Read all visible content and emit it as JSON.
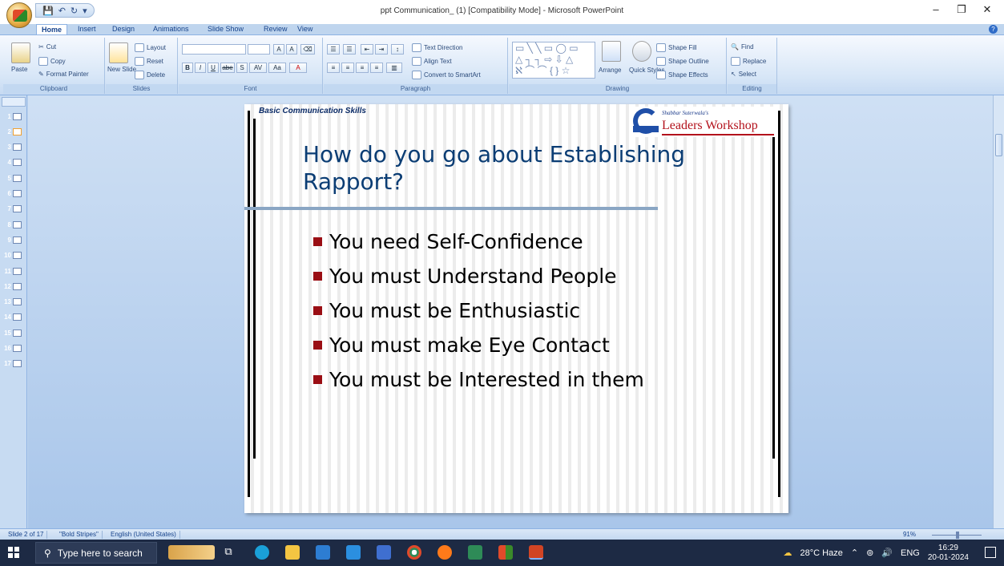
{
  "window": {
    "title": "ppt Communication_ (1) [Compatibility Mode] - Microsoft PowerPoint",
    "minimize": "–",
    "restore": "❐",
    "close": "✕"
  },
  "qat": {
    "save": "💾",
    "undo": "↶",
    "redo": "↻",
    "customize": "▾"
  },
  "tabs": [
    "Home",
    "Insert",
    "Design",
    "Animations",
    "Slide Show",
    "Review",
    "View"
  ],
  "ribbon": {
    "clipboard": {
      "label": "Clipboard",
      "paste": "Paste",
      "cut": "Cut",
      "copy": "Copy",
      "format_painter": "Format Painter"
    },
    "slides": {
      "label": "Slides",
      "new_slide": "New Slide",
      "layout": "Layout",
      "reset": "Reset",
      "delete": "Delete"
    },
    "font": {
      "label": "Font",
      "bold": "B",
      "italic": "I",
      "underline": "U",
      "strike": "abe",
      "shadow": "S",
      "spacing": "AV",
      "case": "Aa",
      "color": "A",
      "grow": "A",
      "shrink": "A"
    },
    "paragraph": {
      "label": "Paragraph",
      "text_direction": "Text Direction",
      "align_text": "Align Text",
      "convert_smartart": "Convert to SmartArt"
    },
    "drawing": {
      "label": "Drawing",
      "arrange": "Arrange",
      "quick_styles": "Quick Styles",
      "shape_fill": "Shape Fill",
      "shape_outline": "Shape Outline",
      "shape_effects": "Shape Effects"
    },
    "editing": {
      "label": "Editing",
      "find": "Find",
      "replace": "Replace",
      "select": "Select"
    }
  },
  "thumbnails": [
    "1",
    "2",
    "3",
    "4",
    "5",
    "6",
    "7",
    "8",
    "9",
    "10",
    "11",
    "12",
    "13",
    "14",
    "15",
    "16",
    "17"
  ],
  "slide": {
    "header": "Basic Communication Skills",
    "brand_small": "Shabbar Suterwala's",
    "brand_main": "Leaders Workshop",
    "title": "How do you go about Establishing Rapport?",
    "bullets": [
      "You need Self-Confidence",
      "You must Understand People",
      "You must be Enthusiastic",
      "You must make Eye Contact",
      "You must be Interested in them"
    ]
  },
  "status": {
    "slide_count": "Slide 2 of 17",
    "theme": "\"Bold Stripes\"",
    "language": "English (United States)",
    "zoom": "91%"
  },
  "taskbar": {
    "search_placeholder": "Type here to search",
    "weather": "28°C  Haze",
    "lang": "ENG",
    "time": "16:29",
    "date": "20-01-2024"
  },
  "colors": {
    "accent": "#15428b",
    "slide_title": "#0b3d74",
    "bullet": "#9a0e14",
    "brand_red": "#b3121c"
  }
}
